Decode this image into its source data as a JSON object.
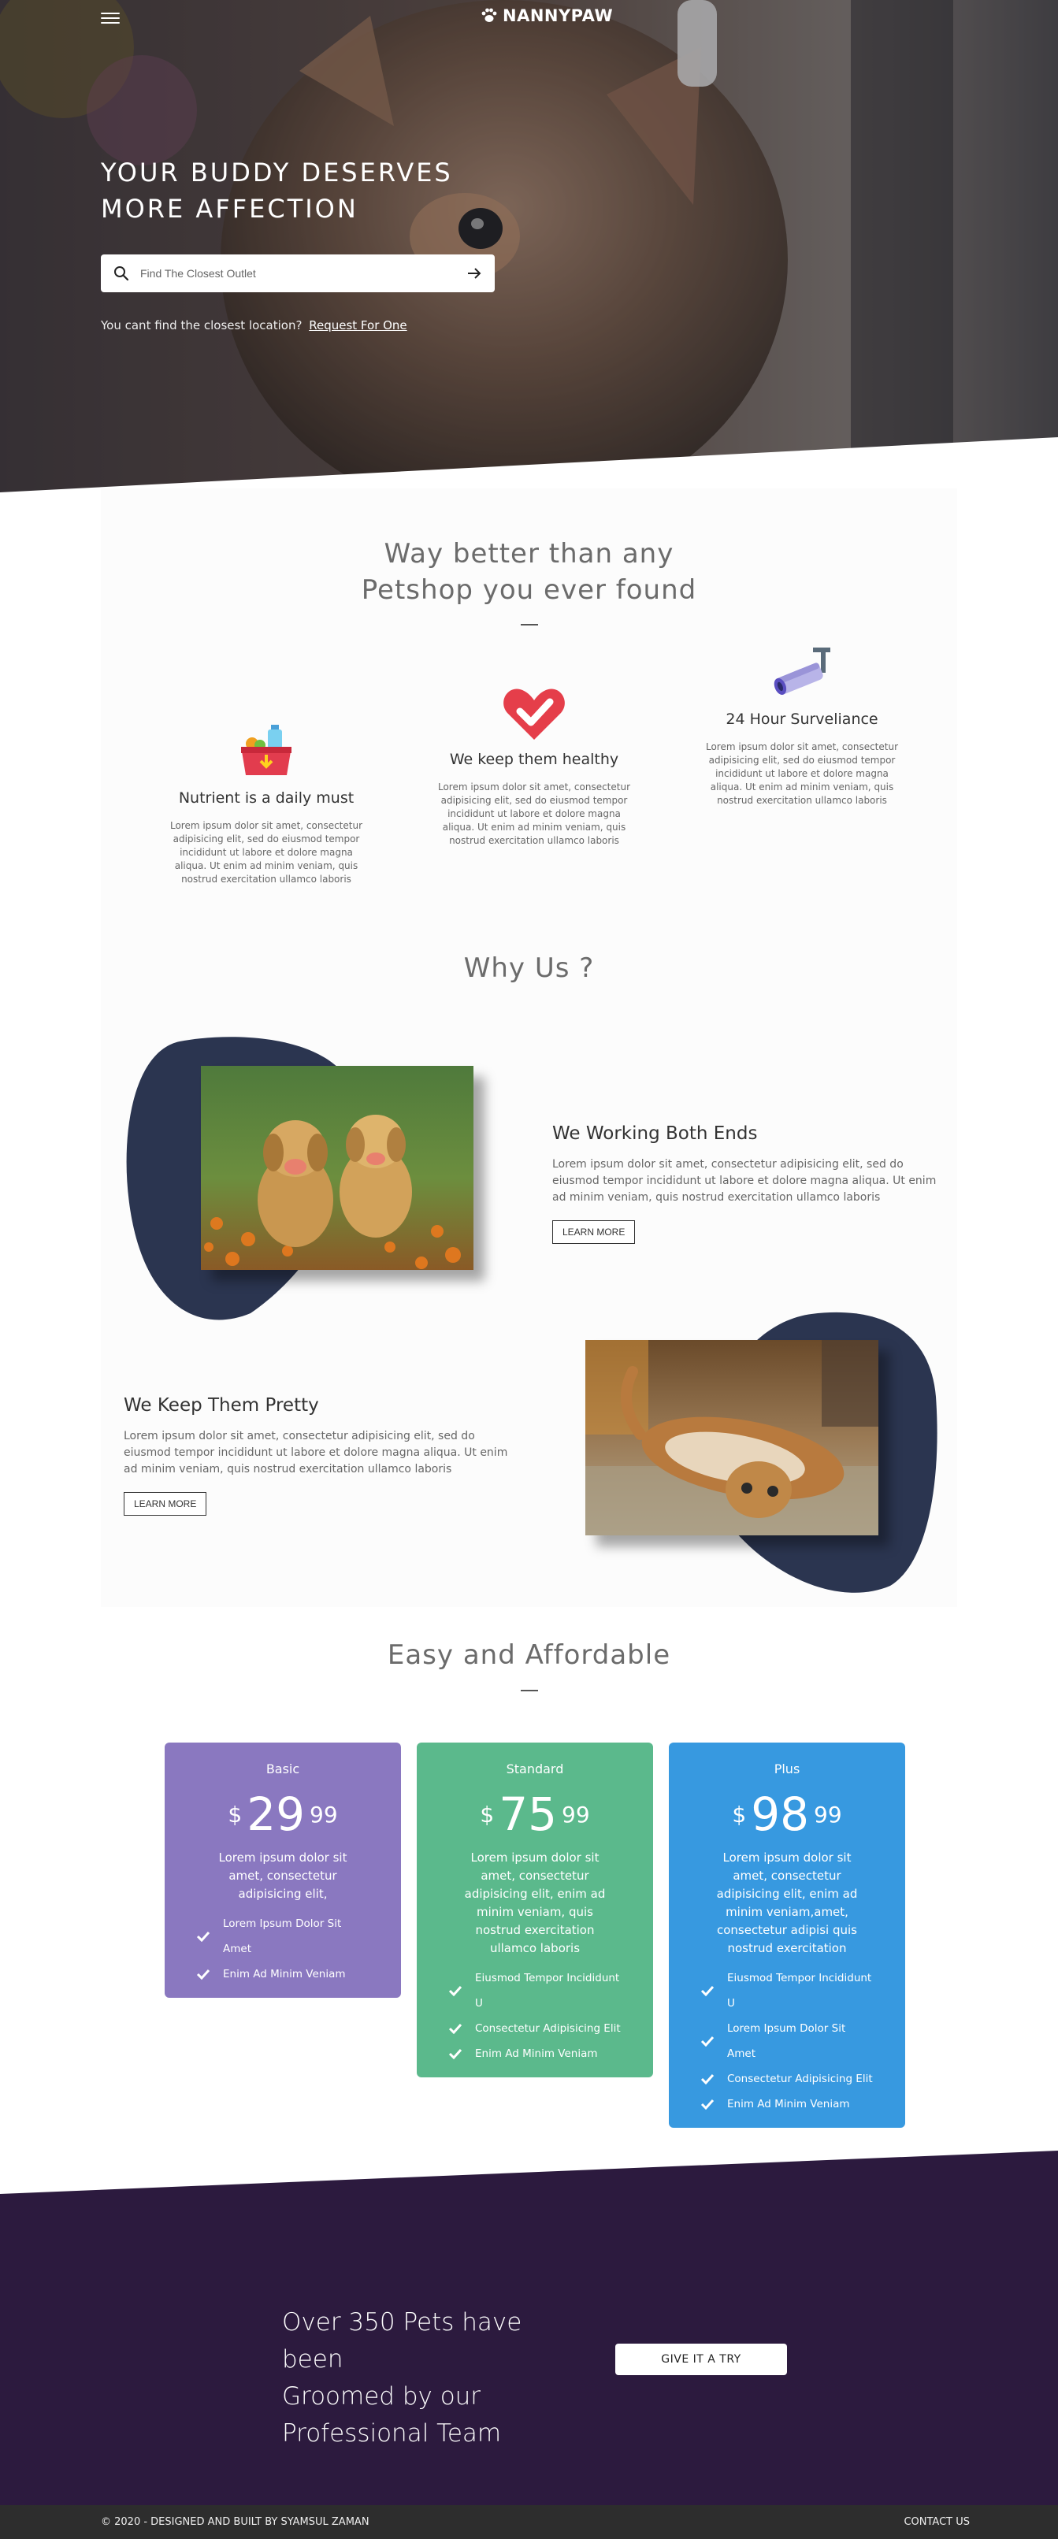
{
  "brand": {
    "name": "NANNYPAW"
  },
  "hero": {
    "title_line1": "YOUR BUDDY DESERVES",
    "title_line2": "MORE AFFECTION",
    "search_placeholder": "Find The Closest Outlet",
    "note": "You cant find the closest location?",
    "note_link": "Request For One"
  },
  "features": {
    "title_line1": "Way better than any",
    "title_line2": "Petshop you ever found",
    "items": [
      {
        "icon": "basket-icon",
        "title": "Nutrient is a daily must",
        "text": "Lorem ipsum dolor sit amet, consectetur adipisicing elit, sed do eiusmod tempor incididunt ut labore et dolore magna aliqua. Ut enim ad minim veniam, quis nostrud exercitation ullamco laboris"
      },
      {
        "icon": "heart-check-icon",
        "title": "We keep them healthy",
        "text": "Lorem ipsum dolor sit amet, consectetur adipisicing elit, sed do eiusmod tempor incididunt ut labore et dolore magna aliqua. Ut enim ad minim veniam, quis nostrud exercitation ullamco laboris"
      },
      {
        "icon": "security-camera-icon",
        "title": "24 Hour Surveliance",
        "text": "Lorem ipsum dolor sit amet, consectetur adipisicing elit, sed do eiusmod tempor incididunt ut labore et dolore magna aliqua. Ut enim ad minim veniam, quis nostrud exercitation ullamco laboris"
      }
    ]
  },
  "why": {
    "title": "Why Us ?",
    "blocks": [
      {
        "title": "We Working Both Ends",
        "text": "Lorem ipsum dolor sit amet, consectetur adipisicing elit, sed do eiusmod tempor incididunt ut labore et dolore magna aliqua. Ut enim ad minim veniam, quis nostrud exercitation ullamco laboris",
        "button": "LEARN MORE"
      },
      {
        "title": "We Keep Them Pretty",
        "text": "Lorem ipsum dolor sit amet, consectetur adipisicing elit, sed do eiusmod tempor incididunt ut labore et dolore magna aliqua. Ut enim ad minim veniam, quis nostrud exercitation ullamco laboris",
        "button": "LEARN MORE"
      }
    ]
  },
  "pricing": {
    "title": "Easy and Affordable",
    "plans": [
      {
        "name": "Basic",
        "currency": "$",
        "price": "29",
        "cents": "99",
        "desc": "Lorem ipsum dolor sit amet, consectetur adipisicing elit,",
        "features": [
          "Lorem Ipsum Dolor Sit Amet",
          "Enim Ad Minim Veniam"
        ],
        "color": "#8a78c0"
      },
      {
        "name": "Standard",
        "currency": "$",
        "price": "75",
        "cents": "99",
        "desc": "Lorem ipsum dolor sit amet, consectetur adipisicing elit, enim ad minim veniam, quis nostrud exercitation ullamco laboris",
        "features": [
          "Eiusmod Tempor Incididunt U",
          "Consectetur Adipisicing Elit",
          "Enim Ad Minim Veniam"
        ],
        "color": "#5bb98c"
      },
      {
        "name": "Plus",
        "currency": "$",
        "price": "98",
        "cents": "99",
        "desc": "Lorem ipsum dolor sit amet, consectetur adipisicing elit, enim ad minim veniam,amet, consectetur adipisi quis nostrud exercitation",
        "features": [
          "Eiusmod Tempor Incididunt U",
          "Lorem Ipsum Dolor Sit Amet",
          "Consectetur Adipisicing Elit",
          "Enim Ad Minim Veniam"
        ],
        "color": "#3799e0"
      }
    ]
  },
  "cta": {
    "line1": "Over 350 Pets have been",
    "line2": "Groomed by our",
    "line3": "Professional Team",
    "button": "GIVE IT A TRY",
    "color": "#2c1a3e"
  },
  "footer": {
    "copy": "© 2020 - DESIGNED AND BUILT BY SYAMSUL ZAMAN",
    "contact": "CONTACT US"
  }
}
